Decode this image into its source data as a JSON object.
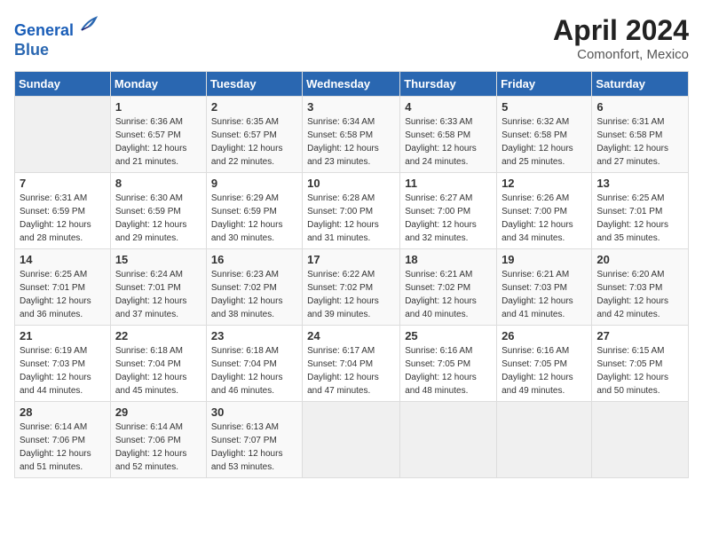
{
  "logo": {
    "line1": "General",
    "line2": "Blue"
  },
  "title": "April 2024",
  "location": "Comonfort, Mexico",
  "days_header": [
    "Sunday",
    "Monday",
    "Tuesday",
    "Wednesday",
    "Thursday",
    "Friday",
    "Saturday"
  ],
  "weeks": [
    [
      {
        "day": "",
        "info": ""
      },
      {
        "day": "1",
        "info": "Sunrise: 6:36 AM\nSunset: 6:57 PM\nDaylight: 12 hours\nand 21 minutes."
      },
      {
        "day": "2",
        "info": "Sunrise: 6:35 AM\nSunset: 6:57 PM\nDaylight: 12 hours\nand 22 minutes."
      },
      {
        "day": "3",
        "info": "Sunrise: 6:34 AM\nSunset: 6:58 PM\nDaylight: 12 hours\nand 23 minutes."
      },
      {
        "day": "4",
        "info": "Sunrise: 6:33 AM\nSunset: 6:58 PM\nDaylight: 12 hours\nand 24 minutes."
      },
      {
        "day": "5",
        "info": "Sunrise: 6:32 AM\nSunset: 6:58 PM\nDaylight: 12 hours\nand 25 minutes."
      },
      {
        "day": "6",
        "info": "Sunrise: 6:31 AM\nSunset: 6:58 PM\nDaylight: 12 hours\nand 27 minutes."
      }
    ],
    [
      {
        "day": "7",
        "info": "Sunrise: 6:31 AM\nSunset: 6:59 PM\nDaylight: 12 hours\nand 28 minutes."
      },
      {
        "day": "8",
        "info": "Sunrise: 6:30 AM\nSunset: 6:59 PM\nDaylight: 12 hours\nand 29 minutes."
      },
      {
        "day": "9",
        "info": "Sunrise: 6:29 AM\nSunset: 6:59 PM\nDaylight: 12 hours\nand 30 minutes."
      },
      {
        "day": "10",
        "info": "Sunrise: 6:28 AM\nSunset: 7:00 PM\nDaylight: 12 hours\nand 31 minutes."
      },
      {
        "day": "11",
        "info": "Sunrise: 6:27 AM\nSunset: 7:00 PM\nDaylight: 12 hours\nand 32 minutes."
      },
      {
        "day": "12",
        "info": "Sunrise: 6:26 AM\nSunset: 7:00 PM\nDaylight: 12 hours\nand 34 minutes."
      },
      {
        "day": "13",
        "info": "Sunrise: 6:25 AM\nSunset: 7:01 PM\nDaylight: 12 hours\nand 35 minutes."
      }
    ],
    [
      {
        "day": "14",
        "info": "Sunrise: 6:25 AM\nSunset: 7:01 PM\nDaylight: 12 hours\nand 36 minutes."
      },
      {
        "day": "15",
        "info": "Sunrise: 6:24 AM\nSunset: 7:01 PM\nDaylight: 12 hours\nand 37 minutes."
      },
      {
        "day": "16",
        "info": "Sunrise: 6:23 AM\nSunset: 7:02 PM\nDaylight: 12 hours\nand 38 minutes."
      },
      {
        "day": "17",
        "info": "Sunrise: 6:22 AM\nSunset: 7:02 PM\nDaylight: 12 hours\nand 39 minutes."
      },
      {
        "day": "18",
        "info": "Sunrise: 6:21 AM\nSunset: 7:02 PM\nDaylight: 12 hours\nand 40 minutes."
      },
      {
        "day": "19",
        "info": "Sunrise: 6:21 AM\nSunset: 7:03 PM\nDaylight: 12 hours\nand 41 minutes."
      },
      {
        "day": "20",
        "info": "Sunrise: 6:20 AM\nSunset: 7:03 PM\nDaylight: 12 hours\nand 42 minutes."
      }
    ],
    [
      {
        "day": "21",
        "info": "Sunrise: 6:19 AM\nSunset: 7:03 PM\nDaylight: 12 hours\nand 44 minutes."
      },
      {
        "day": "22",
        "info": "Sunrise: 6:18 AM\nSunset: 7:04 PM\nDaylight: 12 hours\nand 45 minutes."
      },
      {
        "day": "23",
        "info": "Sunrise: 6:18 AM\nSunset: 7:04 PM\nDaylight: 12 hours\nand 46 minutes."
      },
      {
        "day": "24",
        "info": "Sunrise: 6:17 AM\nSunset: 7:04 PM\nDaylight: 12 hours\nand 47 minutes."
      },
      {
        "day": "25",
        "info": "Sunrise: 6:16 AM\nSunset: 7:05 PM\nDaylight: 12 hours\nand 48 minutes."
      },
      {
        "day": "26",
        "info": "Sunrise: 6:16 AM\nSunset: 7:05 PM\nDaylight: 12 hours\nand 49 minutes."
      },
      {
        "day": "27",
        "info": "Sunrise: 6:15 AM\nSunset: 7:05 PM\nDaylight: 12 hours\nand 50 minutes."
      }
    ],
    [
      {
        "day": "28",
        "info": "Sunrise: 6:14 AM\nSunset: 7:06 PM\nDaylight: 12 hours\nand 51 minutes."
      },
      {
        "day": "29",
        "info": "Sunrise: 6:14 AM\nSunset: 7:06 PM\nDaylight: 12 hours\nand 52 minutes."
      },
      {
        "day": "30",
        "info": "Sunrise: 6:13 AM\nSunset: 7:07 PM\nDaylight: 12 hours\nand 53 minutes."
      },
      {
        "day": "",
        "info": ""
      },
      {
        "day": "",
        "info": ""
      },
      {
        "day": "",
        "info": ""
      },
      {
        "day": "",
        "info": ""
      }
    ]
  ]
}
